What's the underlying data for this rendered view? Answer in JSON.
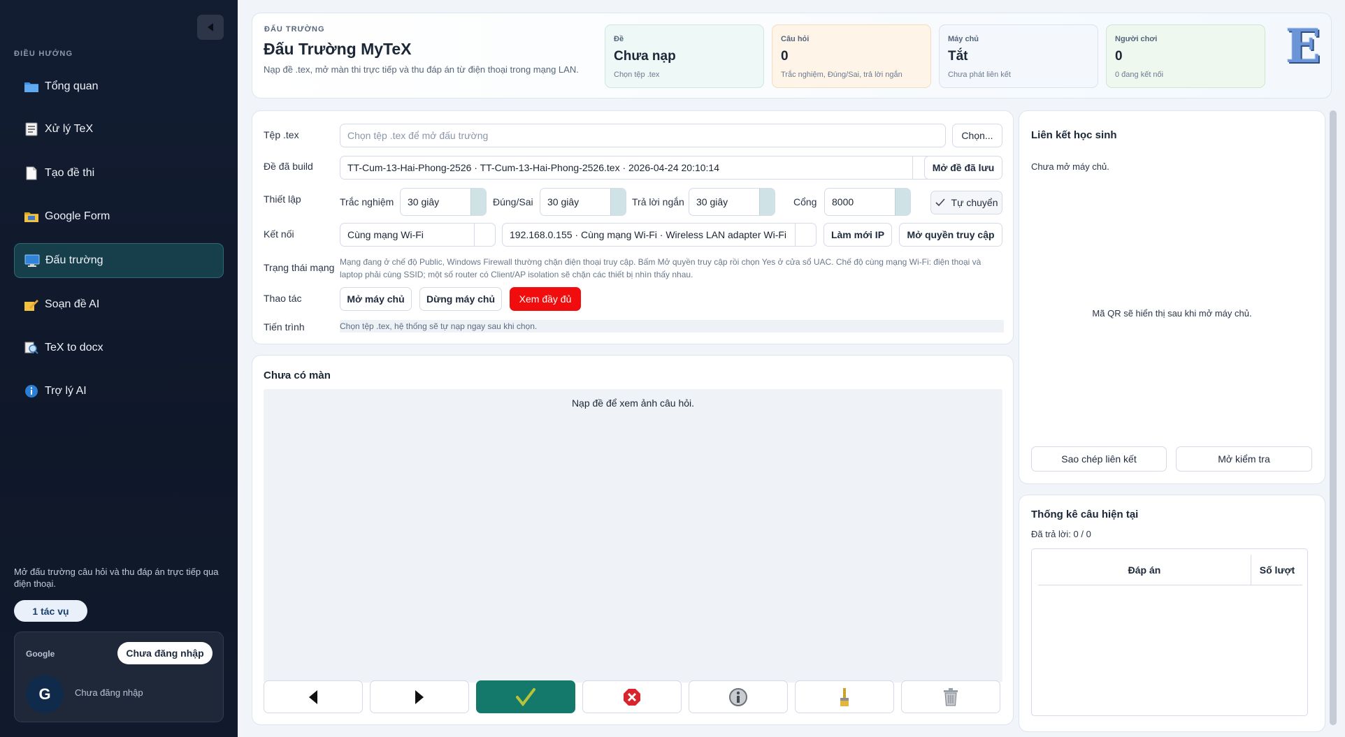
{
  "sidebar": {
    "nav_heading": "ĐIỀU HƯỚNG",
    "items": [
      {
        "label": "Tổng quan",
        "icon": "folder-icon"
      },
      {
        "label": "Xử lý TeX",
        "icon": "document-icon"
      },
      {
        "label": "Tạo đề thi",
        "icon": "page-icon"
      },
      {
        "label": "Google Form",
        "icon": "folder-icon"
      },
      {
        "label": "Đấu trường",
        "icon": "monitor-icon",
        "active": true
      },
      {
        "label": "Soạn đề AI",
        "icon": "pencil-icon"
      },
      {
        "label": "TeX to docx",
        "icon": "magnifier-icon"
      },
      {
        "label": "Trợ lý AI",
        "icon": "info-icon"
      }
    ],
    "description": "Mở đấu trường câu hỏi và thu đáp án trực tiếp qua điện thoại.",
    "task_pill": "1 tác vụ",
    "google": {
      "label": "Google",
      "login_button": "Chưa đăng nhập",
      "avatar_letter": "G",
      "status": "Chưa đăng nhập"
    }
  },
  "header": {
    "eyebrow": "ĐẤU TRƯỜNG",
    "title": "Đấu Trường MyTeX",
    "subtitle": "Nạp đề .tex, mở màn thi trực tiếp và thu đáp án từ điện thoại trong mạng LAN.",
    "stats": [
      {
        "label": "Đề",
        "value": "Chưa nạp",
        "sub": "Chọn tệp .tex",
        "bg": "#eef8f6",
        "border": "#cfe6e2"
      },
      {
        "label": "Câu hỏi",
        "value": "0",
        "sub": "Trắc nghiệm, Đúng/Sai, trả lời ngắn",
        "bg": "#fff4e8",
        "border": "#f3dcc0"
      },
      {
        "label": "Máy chủ",
        "value": "Tắt",
        "sub": "Chưa phát liên kết",
        "bg": "#f4f7fb",
        "border": "#d9e2ee"
      },
      {
        "label": "Người chơi",
        "value": "0",
        "sub": "0 đang kết nối",
        "bg": "#eef8ef",
        "border": "#cfe6d2"
      }
    ],
    "logo_letter": "E"
  },
  "config": {
    "file_label": "Tệp .tex",
    "file_placeholder": "Chọn tệp .tex để mở đấu trường",
    "choose_button": "Chọn...",
    "built_label": "Đề đã build",
    "built_value": "TT-Cum-13-Hai-Phong-2526 · TT-Cum-13-Hai-Phong-2526.tex · 2026-04-24 20:10:14",
    "open_saved_button": "Mở đề đã lưu",
    "settings_label": "Thiết lập",
    "mc_label": "Trắc nghiệm",
    "mc_value": "30 giây",
    "tf_label": "Đúng/Sai",
    "tf_value": "30 giây",
    "short_label": "Trả lời ngắn",
    "short_value": "30 giây",
    "port_label": "Cổng",
    "port_value": "8000",
    "auto_label": "Tự chuyển",
    "auto_checked": true,
    "connect_label": "Kết nối",
    "connect_mode": "Cùng mạng Wi-Fi",
    "connect_ip": "192.168.0.155 · Cùng mạng Wi-Fi · Wireless LAN adapter Wi-Fi",
    "refresh_ip_button": "Làm mới IP",
    "open_access_button": "Mở quyền truy cập",
    "net_status_label": "Trạng thái mạng",
    "net_status_text": "Mạng đang ở chế độ Public, Windows Firewall thường chặn điện thoại truy cập. Bấm Mở quyền truy cập rồi chọn Yes ở cửa sổ UAC. Chế độ cùng mạng Wi-Fi: điện thoại và laptop phải cùng SSID; một số router có Client/AP isolation sẽ chặn các thiết bị nhìn thấy nhau.",
    "actions_label": "Thao tác",
    "start_server_button": "Mở máy chủ",
    "stop_server_button": "Dừng máy chủ",
    "fullscreen_button": "Xem đầy đủ",
    "progress_label": "Tiến trình",
    "progress_text": "Chọn tệp .tex, hệ thống sẽ tự nạp ngay sau khi chọn."
  },
  "viewer": {
    "title": "Chưa có màn",
    "message": "Nạp đề để xem ảnh câu hỏi.",
    "toolbar": [
      "prev-icon",
      "next-icon",
      "check-icon",
      "close-icon",
      "info-icon",
      "brush-icon",
      "trash-icon"
    ]
  },
  "qr": {
    "title": "Liên kết học sinh",
    "status": "Chưa mở máy chủ.",
    "message": "Mã QR sẽ hiển thị sau khi mở máy chủ.",
    "copy_button": "Sao chép liên kết",
    "check_button": "Mở kiểm tra"
  },
  "stats": {
    "title": "Thống kê câu hiện tại",
    "answered": "Đã trả lời: 0 / 0",
    "col_answer": "Đáp án",
    "col_count": "Số lượt"
  }
}
